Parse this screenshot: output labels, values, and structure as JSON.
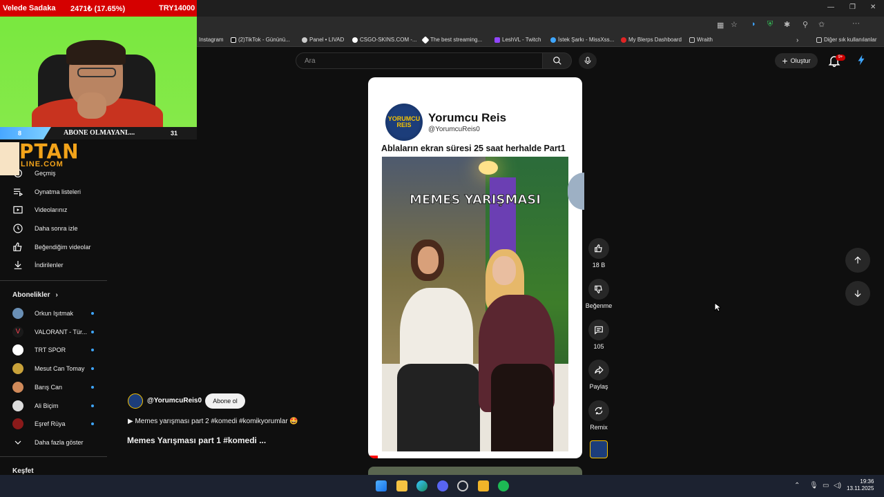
{
  "browser": {
    "bookmarks": [
      {
        "label": "Instagram"
      },
      {
        "label": "(2)TikTok - Gününü..."
      },
      {
        "label": "Panel • LIVAD"
      },
      {
        "label": "CSGO-SKINS.COM -..."
      },
      {
        "label": "The best streaming..."
      },
      {
        "label": "LeshVL - Twitch"
      },
      {
        "label": "İstek Şarkı - MissXss..."
      },
      {
        "label": "My Blerps Dashboard"
      },
      {
        "label": "Wraith"
      }
    ],
    "other_bookmarks": "Diğer sık kullanılanlar"
  },
  "header": {
    "search_placeholder": "Ara",
    "create_label": "Oluştur",
    "notification_count": "9+"
  },
  "sidebar": {
    "items": [
      {
        "label": "Geçmiş",
        "icon": "history-icon"
      },
      {
        "label": "Oynatma listeleri",
        "icon": "playlist-icon"
      },
      {
        "label": "Videolarınız",
        "icon": "video-icon"
      },
      {
        "label": "Daha sonra izle",
        "icon": "clock-icon"
      },
      {
        "label": "Beğendiğim videolar",
        "icon": "thumbs-up-icon"
      },
      {
        "label": "İndirilenler",
        "icon": "download-icon"
      }
    ],
    "subscriptions_title": "Abonelikler",
    "subscriptions": [
      {
        "label": "Orkun Işıtmak",
        "color": "#6a8fb5"
      },
      {
        "label": "VALORANT - Tür...",
        "color": "#1a1a1a"
      },
      {
        "label": "TRT SPOR",
        "color": "#ffffff"
      },
      {
        "label": "Mesut Can Tomay",
        "color": "#c9a23a"
      },
      {
        "label": "Barış Can",
        "color": "#d08a5a"
      },
      {
        "label": "Ali Biçim",
        "color": "#dddddd"
      },
      {
        "label": "Eşref Rüya",
        "color": "#8a1a1a"
      }
    ],
    "show_more": "Daha fazla göster",
    "explore_title": "Keşfet"
  },
  "overlay": {
    "donor_name": "Velede Sadaka",
    "donation_amount": "2471₺ (17.65%)",
    "donation_goal": "TRY14000",
    "goal_current": "8",
    "goal_text": "ABONE OLMAYANL...",
    "goal_target": "31",
    "goal_progress": 0.26,
    "logo_main": "PTAN",
    "logo_sub": "LINE.COM"
  },
  "short": {
    "channel_name": "Yorumcu Reis",
    "channel_handle": "@YorumcuReis0",
    "logo_text_1": "YORUMCU",
    "logo_text_2": "REIS",
    "caption": "Ablaların ekran süresi 25 saat herhalde Part1",
    "overlay_text": "MEMES YARIŞMASI"
  },
  "actions": {
    "like_count": "18 B",
    "dislike_label": "Beğenme",
    "comment_count": "105",
    "share_label": "Paylaş",
    "remix_label": "Remix"
  },
  "info": {
    "channel": "@YorumcuReis0",
    "subscribe_label": "Abone ol",
    "description": "▶ Memes yarışması part 2 #komedi #komikyorumlar 🤩",
    "title": "Memes Yarışması part 1 #komedi ..."
  },
  "taskbar": {
    "time": "19:36",
    "date": "13.11.2025"
  }
}
